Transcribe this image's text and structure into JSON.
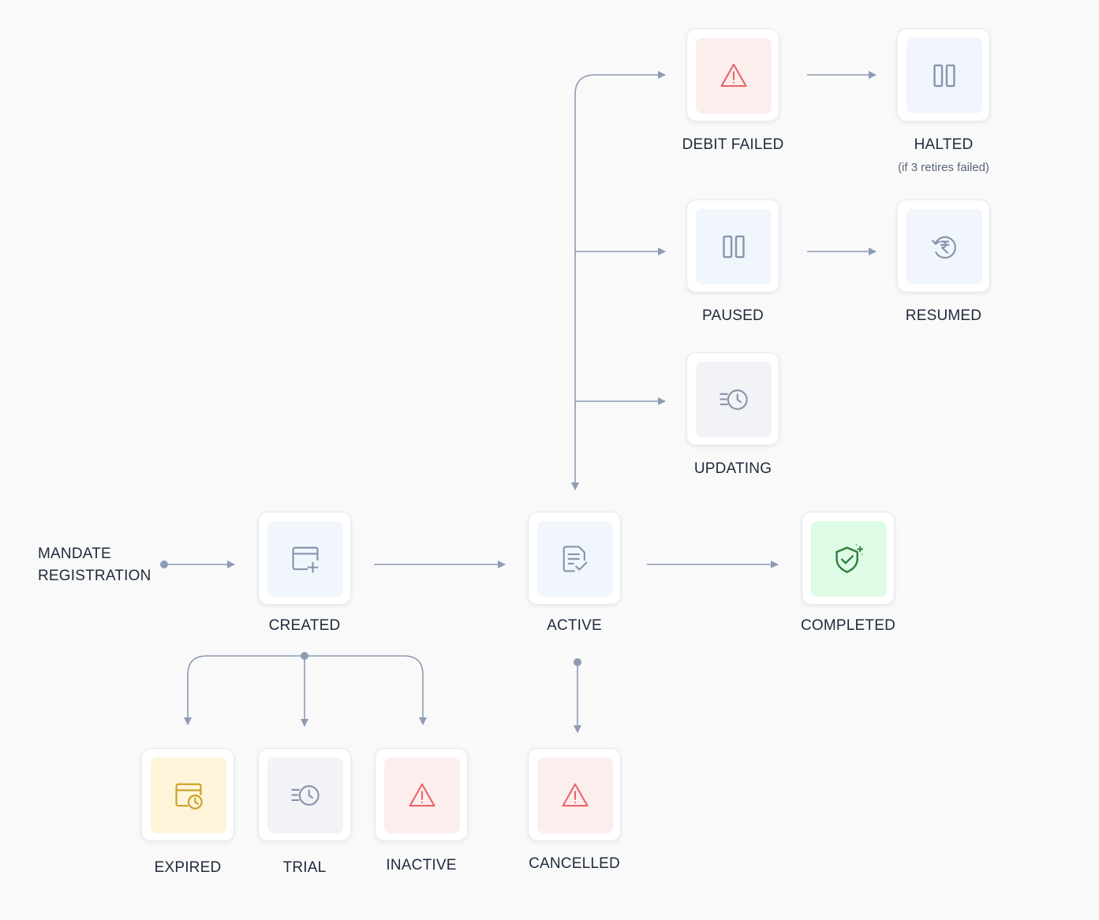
{
  "start": {
    "line1": "MANDATE",
    "line2": "REGISTRATION"
  },
  "states": {
    "debit_failed": {
      "label": "DEBIT FAILED",
      "icon": "warning-icon",
      "tone": "#fdeeee"
    },
    "halted": {
      "label": "HALTED",
      "sublabel": "(if 3 retires failed)",
      "icon": "pause-icon",
      "tone": "#f1f6fd"
    },
    "paused": {
      "label": "PAUSED",
      "icon": "pause-icon",
      "tone": "#f1f6fd"
    },
    "resumed": {
      "label": "RESUMED",
      "icon": "rupee-refresh-icon",
      "tone": "#f1f6fd"
    },
    "updating": {
      "label": "UPDATING",
      "icon": "timer-icon",
      "tone": "#f1f3f7"
    },
    "created": {
      "label": "CREATED",
      "icon": "card-add-icon",
      "tone": "#f1f6fd"
    },
    "active": {
      "label": "ACTIVE",
      "icon": "document-check-icon",
      "tone": "#f1f6fd"
    },
    "completed": {
      "label": "COMPLETED",
      "icon": "shield-check-icon",
      "tone": "#defbe6"
    },
    "expired": {
      "label": "EXPIRED",
      "icon": "card-clock-icon",
      "tone": "#fdf4d9"
    },
    "trial": {
      "label": "TRIAL",
      "icon": "timer-icon",
      "tone": "#f1f3f7"
    },
    "inactive": {
      "label": "INACTIVE",
      "icon": "warning-icon",
      "tone": "#fdeeee"
    },
    "cancelled": {
      "label": "CANCELLED",
      "icon": "warning-icon",
      "tone": "#fdeeee"
    }
  },
  "colors": {
    "connector": "#8d9bb3",
    "warning": "#e8676a",
    "icon_slate": "#8795ab",
    "icon_gold": "#c9a227",
    "icon_green": "#2e7d3a",
    "label_text": "#1e2a3b",
    "sublabel_text": "#5b6778"
  }
}
